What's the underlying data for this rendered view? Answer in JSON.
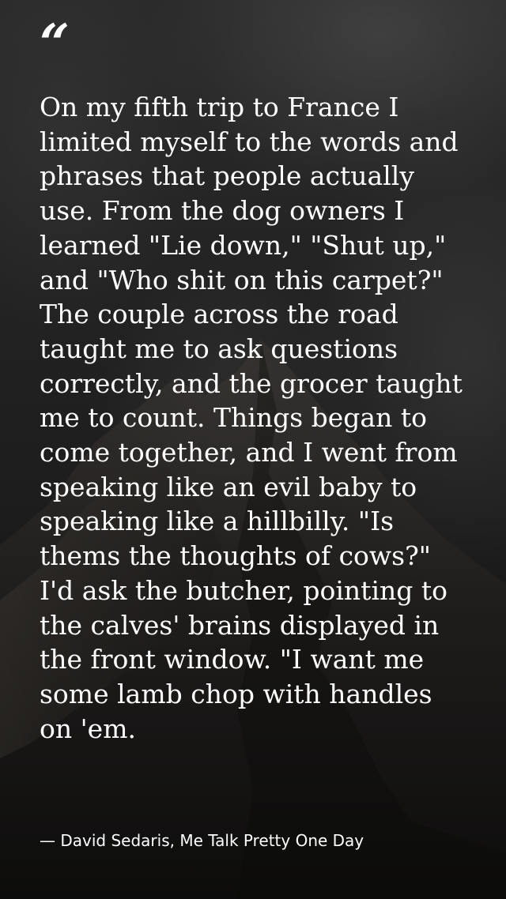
{
  "quote": {
    "mark": "“",
    "text": "On my fifth trip to France I limited myself to the words and phrases that people actually use. From the dog owners I learned \"Lie down,\" \"Shut up,\" and \"Who shit on this carpet?\" The couple across the road taught me to ask questions correctly, and the grocer taught me to count. Things began to come together, and I went from speaking like an evil baby to speaking like a hillbilly. \"Is thems the thoughts of cows?\" I'd ask the butcher, pointing to the calves' brains displayed in the front window. \"I want me some lamb chop with handles on 'em.",
    "attribution": "— David Sedaris, Me Talk Pretty One Day"
  }
}
